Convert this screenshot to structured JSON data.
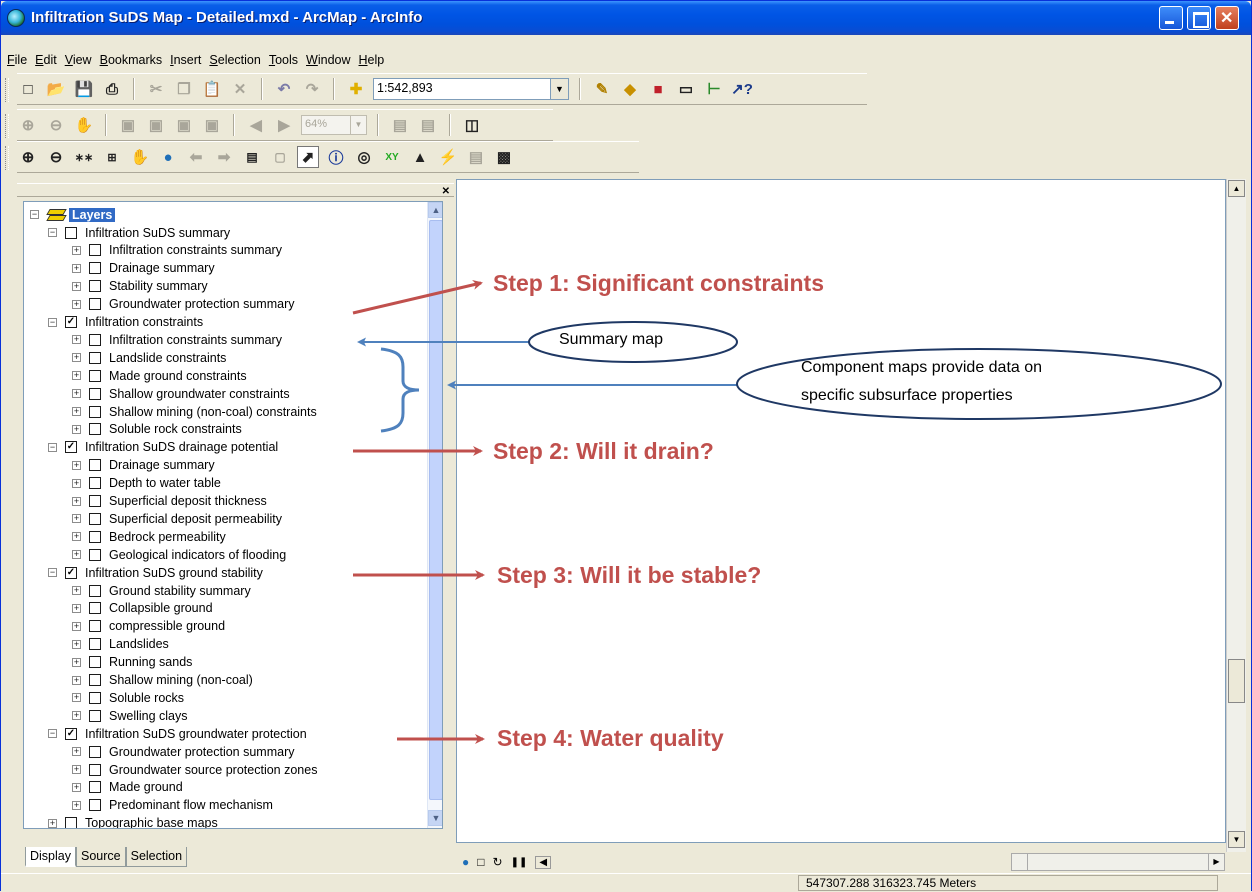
{
  "window": {
    "title": "Infiltration SuDS Map - Detailed.mxd - ArcMap - ArcInfo"
  },
  "menu": [
    "File",
    "Edit",
    "View",
    "Bookmarks",
    "Insert",
    "Selection",
    "Tools",
    "Window",
    "Help"
  ],
  "toolbar": {
    "scale_value": "1:542,893",
    "zoom_value": "64%"
  },
  "toc": {
    "root_label": "Layers",
    "items": [
      {
        "label": "Infiltration SuDS summary",
        "level": 1,
        "checked": false,
        "expander": "−"
      },
      {
        "label": "Infiltration constraints summary",
        "level": 2,
        "checked": false,
        "expander": "+"
      },
      {
        "label": "Drainage summary",
        "level": 2,
        "checked": false,
        "expander": "+"
      },
      {
        "label": "Stability summary",
        "level": 2,
        "checked": false,
        "expander": "+"
      },
      {
        "label": "Groundwater protection summary",
        "level": 2,
        "checked": false,
        "expander": "+"
      },
      {
        "label": "Infiltration constraints",
        "level": 1,
        "checked": true,
        "expander": "−"
      },
      {
        "label": "Infiltration constraints summary",
        "level": 2,
        "checked": false,
        "expander": "+"
      },
      {
        "label": "Landslide constraints",
        "level": 2,
        "checked": false,
        "expander": "+"
      },
      {
        "label": "Made ground constraints",
        "level": 2,
        "checked": false,
        "expander": "+"
      },
      {
        "label": "Shallow groundwater constraints",
        "level": 2,
        "checked": false,
        "expander": "+"
      },
      {
        "label": "Shallow mining (non-coal) constraints",
        "level": 2,
        "checked": false,
        "expander": "+"
      },
      {
        "label": "Soluble rock constraints",
        "level": 2,
        "checked": false,
        "expander": "+"
      },
      {
        "label": "Infiltration SuDS drainage potential",
        "level": 1,
        "checked": true,
        "expander": "−"
      },
      {
        "label": "Drainage summary",
        "level": 2,
        "checked": false,
        "expander": "+"
      },
      {
        "label": "Depth to water table",
        "level": 2,
        "checked": false,
        "expander": "+"
      },
      {
        "label": "Superficial deposit thickness",
        "level": 2,
        "checked": false,
        "expander": "+"
      },
      {
        "label": "Superficial deposit permeability",
        "level": 2,
        "checked": false,
        "expander": "+"
      },
      {
        "label": "Bedrock permeability",
        "level": 2,
        "checked": false,
        "expander": "+"
      },
      {
        "label": "Geological indicators of flooding",
        "level": 2,
        "checked": false,
        "expander": "+"
      },
      {
        "label": "Infiltration SuDS ground stability",
        "level": 1,
        "checked": true,
        "expander": "−"
      },
      {
        "label": "Ground stability summary",
        "level": 2,
        "checked": false,
        "expander": "+"
      },
      {
        "label": "Collapsible ground",
        "level": 2,
        "checked": false,
        "expander": "+"
      },
      {
        "label": "compressible ground",
        "level": 2,
        "checked": false,
        "expander": "+"
      },
      {
        "label": "Landslides",
        "level": 2,
        "checked": false,
        "expander": "+"
      },
      {
        "label": "Running sands",
        "level": 2,
        "checked": false,
        "expander": "+"
      },
      {
        "label": "Shallow mining (non-coal)",
        "level": 2,
        "checked": false,
        "expander": "+"
      },
      {
        "label": "Soluble rocks",
        "level": 2,
        "checked": false,
        "expander": "+"
      },
      {
        "label": "Swelling clays",
        "level": 2,
        "checked": false,
        "expander": "+"
      },
      {
        "label": "Infiltration SuDS groundwater protection",
        "level": 1,
        "checked": true,
        "expander": "−"
      },
      {
        "label": "Groundwater protection summary",
        "level": 2,
        "checked": false,
        "expander": "+"
      },
      {
        "label": "Groundwater source protection zones",
        "level": 2,
        "checked": false,
        "expander": "+"
      },
      {
        "label": "Made ground",
        "level": 2,
        "checked": false,
        "expander": "+"
      },
      {
        "label": "Predominant flow mechanism",
        "level": 2,
        "checked": false,
        "expander": "+"
      },
      {
        "label": "Topographic base maps",
        "level": 1,
        "checked": false,
        "expander": "+"
      }
    ],
    "tabs": [
      "Display",
      "Source",
      "Selection"
    ]
  },
  "annotations": {
    "step1": "Step 1: Significant constraints",
    "step2": "Step 2: Will it drain?",
    "step3": "Step 3: Will it be stable?",
    "step4": "Step 4: Water quality",
    "summary_callout": "Summary map",
    "component_callout_line1": "Component maps provide data on",
    "component_callout_line2": "specific subsurface properties"
  },
  "status": {
    "coordinates": "547307.288  316323.745 Meters"
  },
  "colors": {
    "title_bar": "#0055e5",
    "step_text": "#c0504d",
    "callout_arrow": "#4f81bd",
    "callout_border": "#1f3864",
    "layers_highlight": "#316ac5"
  }
}
